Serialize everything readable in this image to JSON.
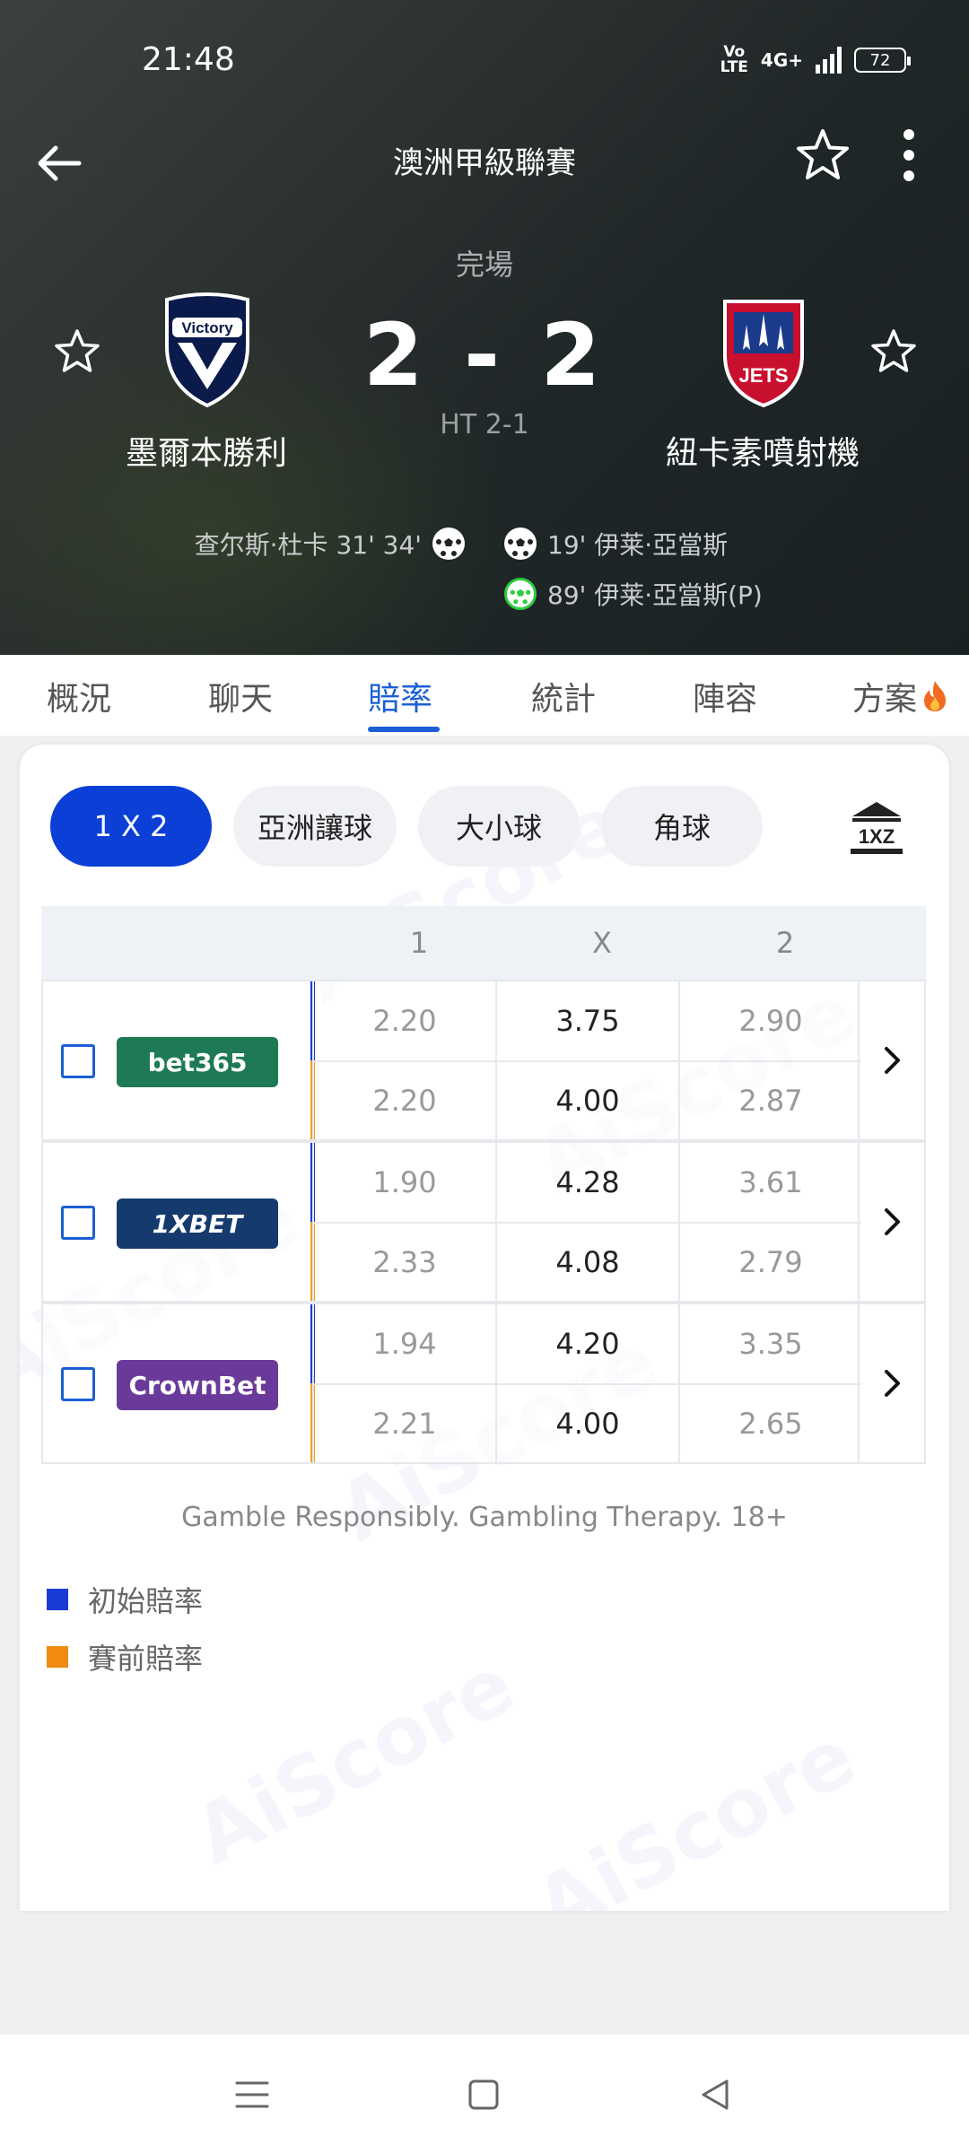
{
  "status_bar": {
    "time": "21:48",
    "network": "4G+",
    "battery": "72"
  },
  "header": {
    "league_title": "澳洲甲級聯賽",
    "match_status": "完場",
    "score": "2 - 2",
    "half_time": "HT 2-1",
    "home_team": "墨爾本勝利",
    "away_team": "紐卡素噴射機",
    "home_logo_text": "Victory",
    "away_logo_text": "JETS",
    "home_events": [
      {
        "text": "查尔斯·杜卡 31' 34'"
      }
    ],
    "away_events": [
      {
        "text": "19' 伊莱·亞當斯",
        "type": "goal"
      },
      {
        "text": "89' 伊莱·亞當斯(P)",
        "type": "penalty"
      }
    ]
  },
  "tabs": [
    "概況",
    "聊天",
    "賠率",
    "統計",
    "陣容",
    "方案"
  ],
  "active_tab": "賠率",
  "odds": {
    "market_pills": [
      "1 X 2",
      "亞洲讓球",
      "大小球",
      "角球"
    ],
    "active_pill": "1 X 2",
    "columns": [
      "1",
      "X",
      "2"
    ],
    "bookmakers": [
      {
        "name": "bet365",
        "color": "#1e7a55",
        "initial": [
          "2.20",
          "3.75",
          "2.90"
        ],
        "pre_match": [
          "2.20",
          "4.00",
          "2.87"
        ]
      },
      {
        "name": "1XBET",
        "color": "#153a6e",
        "initial": [
          "1.90",
          "4.28",
          "3.61"
        ],
        "pre_match": [
          "2.33",
          "4.08",
          "2.79"
        ]
      },
      {
        "name": "CrownBet",
        "color": "#6a3a9a",
        "initial": [
          "1.94",
          "4.20",
          "3.35"
        ],
        "pre_match": [
          "2.21",
          "4.00",
          "2.65"
        ]
      }
    ],
    "disclaimer": "Gamble Responsibly. Gambling Therapy. 18+",
    "legend": [
      {
        "label": "初始賠率",
        "color": "#1b3bd6"
      },
      {
        "label": "賽前賠率",
        "color": "#f08a10"
      }
    ],
    "watermark": "AiScore"
  }
}
